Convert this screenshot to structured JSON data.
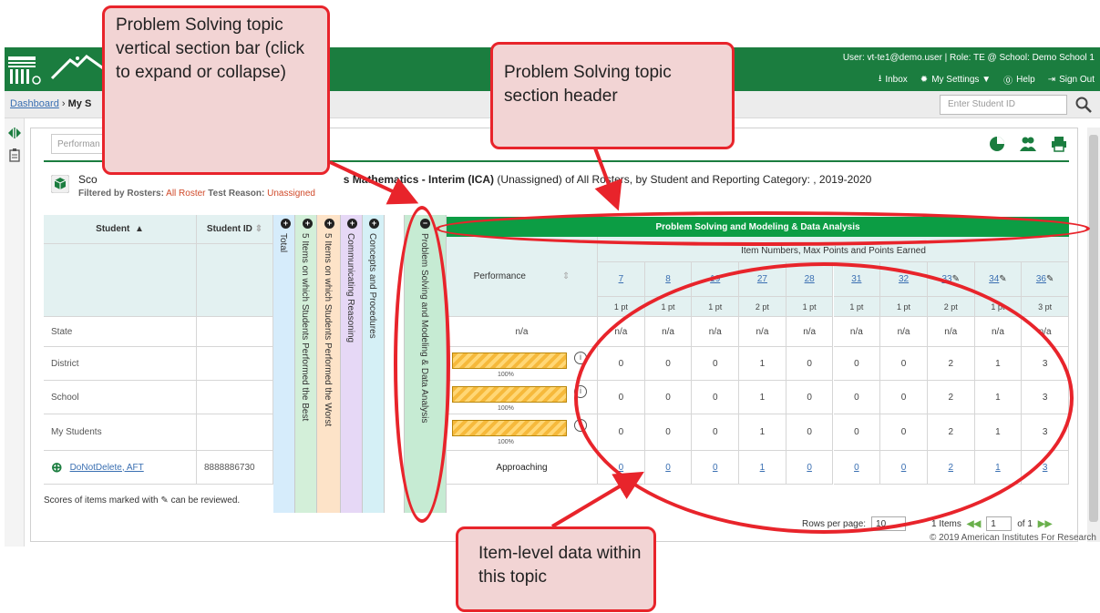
{
  "header": {
    "user_info": "User: vt-te1@demo.user  |  Role: TE @ School: Demo School 1",
    "nav": [
      "Inbox",
      "My Settings ▼",
      "Help",
      "Sign Out"
    ]
  },
  "breadcrumb": {
    "root": "Dashboard",
    "sep": "›",
    "current": "My S"
  },
  "student_search": {
    "placeholder": "Enter Student ID"
  },
  "performance_select": "Performan",
  "report": {
    "title_start": "Sco",
    "title_bold": "s Mathematics - Interim (ICA)",
    "title_rest": "(Unassigned) of All Rosters, by Student and Reporting Category: , 2019-2020",
    "filter_label": "Filtered by Rosters:",
    "filter_value": "All Roster",
    "filter_reason_label": "Test Reason:",
    "filter_reason_value": "Unassigned"
  },
  "table": {
    "col_student": "Student",
    "col_student_id": "Student ID",
    "vertical_cols": [
      "Total",
      "5 Items on which Students Performed the Best",
      "5 Items on which Students Performed the Worst",
      "Communicating Reasoning",
      "Concepts and Procedures",
      "Problem Solving and Modeling & Data Analysis"
    ],
    "section_header": "Problem Solving and Modeling & Data Analysis",
    "items_caption": "Item Numbers, Max Points and Points Earned",
    "performance_label": "Performance",
    "items": [
      {
        "num": "7",
        "pts": "1 pt"
      },
      {
        "num": "8",
        "pts": "1 pt"
      },
      {
        "num": "19",
        "pts": "1 pt"
      },
      {
        "num": "27",
        "pts": "2 pt"
      },
      {
        "num": "28",
        "pts": "1 pt"
      },
      {
        "num": "31",
        "pts": "1 pt"
      },
      {
        "num": "32",
        "pts": "1 pt"
      },
      {
        "num": "33",
        "pts": "2 pt"
      },
      {
        "num": "34",
        "pts": "1 pt"
      },
      {
        "num": "36",
        "pts": "3 pt"
      }
    ],
    "rows": [
      {
        "label": "State",
        "student_id": "",
        "performance": "n/a",
        "values": [
          "n/a",
          "n/a",
          "n/a",
          "n/a",
          "n/a",
          "n/a",
          "n/a",
          "n/a",
          "n/a",
          "n/a"
        ]
      },
      {
        "label": "District",
        "student_id": "",
        "performance_pct": "100%",
        "values": [
          "0",
          "0",
          "0",
          "1",
          "0",
          "0",
          "0",
          "2",
          "1",
          "3"
        ]
      },
      {
        "label": "School",
        "student_id": "",
        "performance_pct": "100%",
        "values": [
          "0",
          "0",
          "0",
          "1",
          "0",
          "0",
          "0",
          "2",
          "1",
          "3"
        ]
      },
      {
        "label": "My Students",
        "student_id": "",
        "performance_pct": "100%",
        "values": [
          "0",
          "0",
          "0",
          "1",
          "0",
          "0",
          "0",
          "2",
          "1",
          "3"
        ]
      },
      {
        "label": "DoNotDelete, AFT",
        "student_id": "8888886730",
        "performance": "Approaching",
        "values": [
          "0",
          "0",
          "0",
          "1",
          "0",
          "0",
          "0",
          "2",
          "1",
          "3"
        ]
      }
    ],
    "bar_fill": 1.0
  },
  "footer": {
    "note_before": "Scores of items marked with",
    "note_after": "can be reviewed.",
    "rows_per_page_label": "Rows per page:",
    "rows_per_page": "10",
    "items_label": "1 Items",
    "page_current": "1",
    "page_of": "of 1",
    "copyright": "© 2019 American Institutes For Research"
  },
  "callouts": {
    "vertical_bar": "Problem Solving topic vertical section bar (click to expand or collapse)",
    "section_header": "Problem Solving topic section header",
    "item_level": "Item-level data within this topic"
  },
  "colors": {
    "brand_green": "#1b7d3f",
    "section_green": "#0c9d44",
    "callout_red": "#e8242b",
    "callout_fill": "#f2d4d4"
  }
}
